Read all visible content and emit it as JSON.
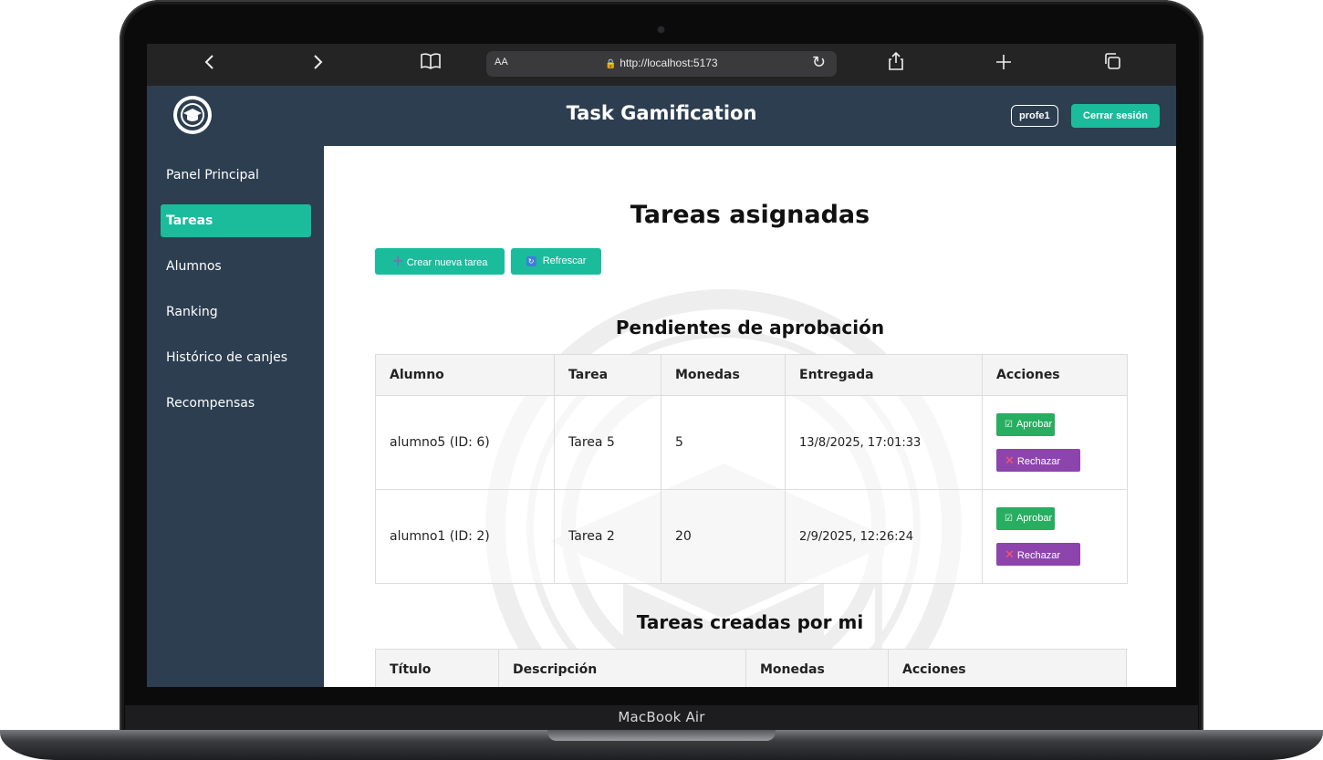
{
  "device": {
    "label": "MacBook Air"
  },
  "browser": {
    "back_icon": "chevron-left",
    "forward_icon": "chevron-right",
    "reader_text": "AA",
    "url": "http://localhost:5173",
    "nav_back": "‹",
    "nav_forward": "›"
  },
  "header": {
    "title": "Task Gamification",
    "user": "profe1",
    "logout_label": "Cerrar sesión"
  },
  "sidebar": {
    "items": [
      {
        "label": "Panel Principal",
        "active": false
      },
      {
        "label": "Tareas",
        "active": true
      },
      {
        "label": "Alumnos",
        "active": false
      },
      {
        "label": "Ranking",
        "active": false
      },
      {
        "label": "Histórico de canjes",
        "active": false
      },
      {
        "label": "Recompensas",
        "active": false
      }
    ]
  },
  "main": {
    "title": "Tareas asignadas",
    "create_label": "Crear nueva tarea",
    "refresh_label": "Refrescar",
    "pending": {
      "title": "Pendientes de aprobación",
      "columns": [
        "Alumno",
        "Tarea",
        "Monedas",
        "Entregada",
        "Acciones"
      ],
      "rows": [
        {
          "alumno": "alumno5 (ID: 6)",
          "tarea": "Tarea 5",
          "monedas": "5",
          "entregada": "13/8/2025, 17:01:33"
        },
        {
          "alumno": "alumno1 (ID: 2)",
          "tarea": "Tarea 2",
          "monedas": "20",
          "entregada": "2/9/2025, 12:26:24"
        }
      ],
      "approve_label": "Aprobar",
      "reject_label": "Rechazar"
    },
    "created": {
      "title": "Tareas creadas por mi",
      "columns": [
        "Título",
        "Descripción",
        "Monedas",
        "Acciones"
      ]
    }
  },
  "colors": {
    "sidebar": "#2c3e50",
    "accent": "#1abc9c",
    "approve": "#27ae60",
    "reject": "#8e44ad"
  }
}
